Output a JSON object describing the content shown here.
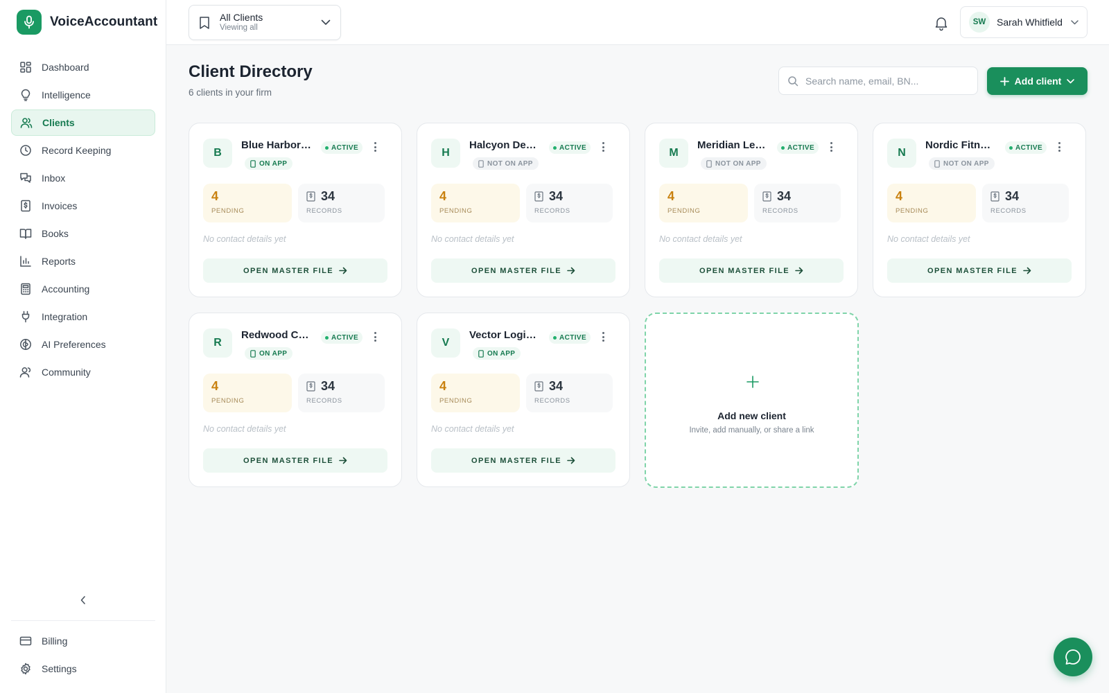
{
  "app": {
    "name": "VoiceAccountant"
  },
  "sidebar": {
    "items": [
      {
        "label": "Dashboard",
        "icon": "grid-icon",
        "active": false
      },
      {
        "label": "Intelligence",
        "icon": "lightbulb-icon",
        "active": false
      },
      {
        "label": "Clients",
        "icon": "users-icon",
        "active": true
      },
      {
        "label": "Record Keeping",
        "icon": "clock-icon",
        "active": false
      },
      {
        "label": "Inbox",
        "icon": "chat-bubbles-icon",
        "active": false
      },
      {
        "label": "Invoices",
        "icon": "dollar-document-icon",
        "active": false
      },
      {
        "label": "Books",
        "icon": "open-book-icon",
        "active": false
      },
      {
        "label": "Reports",
        "icon": "bar-chart-icon",
        "active": false
      },
      {
        "label": "Accounting",
        "icon": "calculator-icon",
        "active": false
      },
      {
        "label": "Integration",
        "icon": "plug-icon",
        "active": false
      },
      {
        "label": "AI Preferences",
        "icon": "ai-brain-icon",
        "active": false
      },
      {
        "label": "Community",
        "icon": "community-icon",
        "active": false
      }
    ],
    "bottom": [
      {
        "label": "Billing",
        "icon": "credit-card-icon"
      },
      {
        "label": "Settings",
        "icon": "gear-icon"
      }
    ]
  },
  "topbar": {
    "client_switch": {
      "title": "All Clients",
      "subtitle": "Viewing all"
    },
    "user": {
      "initials": "SW",
      "name": "Sarah Whitfield"
    }
  },
  "main": {
    "title": "Client Directory",
    "subtitle": "6 clients in your firm",
    "search": {
      "placeholder": "Search name, email, BN..."
    },
    "add_client_label": "Add client",
    "stat_labels": {
      "pending": "PENDING",
      "records": "RECORDS"
    },
    "contact_empty": "No contact details yet",
    "open_label": "OPEN MASTER FILE",
    "clients": [
      {
        "initial": "B",
        "name": "Blue Harbor ...",
        "status": "ACTIVE",
        "app": "ON APP",
        "on_app": true,
        "pending": "4",
        "records": "34"
      },
      {
        "initial": "H",
        "name": "Halcyon Desi...",
        "status": "ACTIVE",
        "app": "NOT ON APP",
        "on_app": false,
        "pending": "4",
        "records": "34"
      },
      {
        "initial": "M",
        "name": "Meridian Legal",
        "status": "ACTIVE",
        "app": "NOT ON APP",
        "on_app": false,
        "pending": "4",
        "records": "34"
      },
      {
        "initial": "N",
        "name": "Nordic Fitnes...",
        "status": "ACTIVE",
        "app": "NOT ON APP",
        "on_app": false,
        "pending": "4",
        "records": "34"
      },
      {
        "initial": "R",
        "name": "Redwood Co...",
        "status": "ACTIVE",
        "app": "ON APP",
        "on_app": true,
        "pending": "4",
        "records": "34"
      },
      {
        "initial": "V",
        "name": "Vector Logist...",
        "status": "ACTIVE",
        "app": "ON APP",
        "on_app": true,
        "pending": "4",
        "records": "34"
      }
    ],
    "add_card": {
      "title": "Add new client",
      "subtitle": "Invite, add manually, or share a link"
    }
  },
  "colors": {
    "accent": "#1a8f5c",
    "accent_light": "#eef8f3",
    "pending": "#c9810f"
  }
}
